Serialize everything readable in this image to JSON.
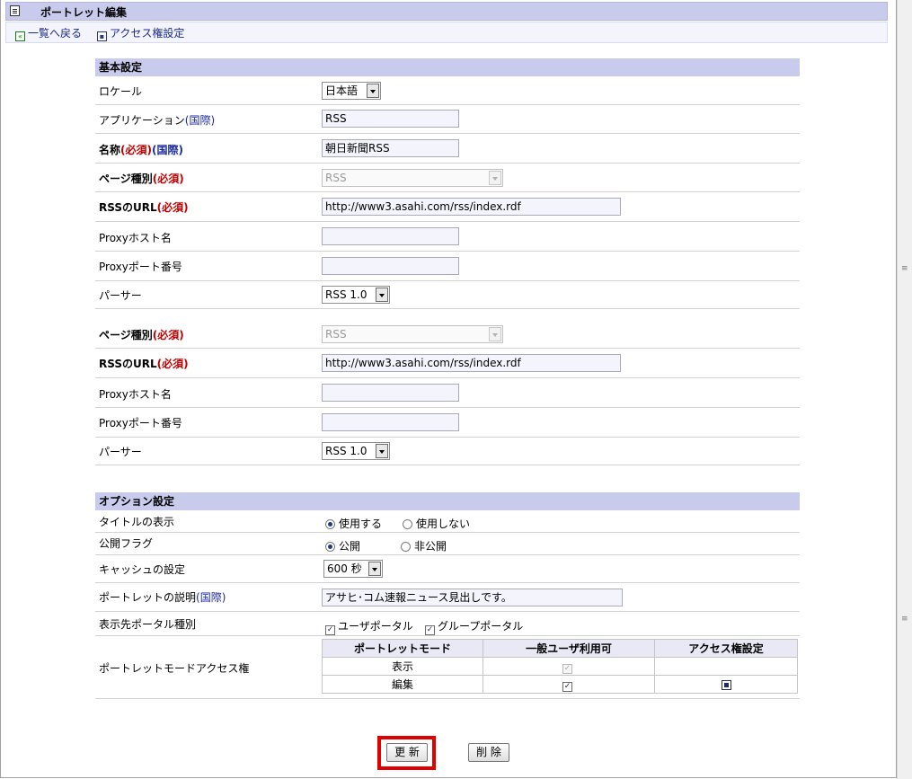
{
  "title": "ポートレット編集",
  "nav": {
    "back": "一覧へ戻る",
    "access": "アクセス権設定"
  },
  "basic": {
    "header": "基本設定",
    "locale": {
      "label": "ロケール",
      "value": "日本語"
    },
    "application": {
      "label": "アプリケーション",
      "intl": "(国際)",
      "value": "RSS"
    },
    "name": {
      "label": "名称",
      "req": "(必須)",
      "intl": "(国際)",
      "value": "朝日新聞RSS"
    },
    "blocks": [
      {
        "page_type": {
          "label": "ページ種別",
          "req": "(必須)",
          "value": "RSS"
        },
        "rss_url": {
          "label": "RSSのURL",
          "req": "(必須)",
          "value": "http://www3.asahi.com/rss/index.rdf"
        },
        "proxy_host": {
          "label": "Proxyホスト名",
          "value": ""
        },
        "proxy_port": {
          "label": "Proxyポート番号",
          "value": ""
        },
        "parser": {
          "label": "パーサー",
          "value": "RSS 1.0"
        }
      },
      {
        "page_type": {
          "label": "ページ種別",
          "req": "(必須)",
          "value": "RSS"
        },
        "rss_url": {
          "label": "RSSのURL",
          "req": "(必須)",
          "value": "http://www3.asahi.com/rss/index.rdf"
        },
        "proxy_host": {
          "label": "Proxyホスト名",
          "value": ""
        },
        "proxy_port": {
          "label": "Proxyポート番号",
          "value": ""
        },
        "parser": {
          "label": "パーサー",
          "value": "RSS 1.0"
        }
      }
    ]
  },
  "options": {
    "header": "オプション設定",
    "title_display": {
      "label": "タイトルの表示",
      "opt_on": "使用する",
      "opt_off": "使用しない"
    },
    "public_flag": {
      "label": "公開フラグ",
      "opt_on": "公開",
      "opt_off": "非公開"
    },
    "cache": {
      "label": "キャッシュの設定",
      "value": "600 秒"
    },
    "description": {
      "label": "ポートレットの説明",
      "intl": "(国際)",
      "value": "アサヒ･コム速報ニュース見出しです。"
    },
    "portal_type": {
      "label": "表示先ポータル種別",
      "opt1": "ユーザポータル",
      "opt2": "グループポータル"
    },
    "mode_access": {
      "label": "ポートレットモードアクセス権",
      "headers": [
        "ポートレットモード",
        "一般ユーザ利用可",
        "アクセス権設定"
      ],
      "rows": [
        {
          "mode": "表示"
        },
        {
          "mode": "編集"
        }
      ]
    }
  },
  "buttons": {
    "update": "更 新",
    "delete": "削 除"
  }
}
